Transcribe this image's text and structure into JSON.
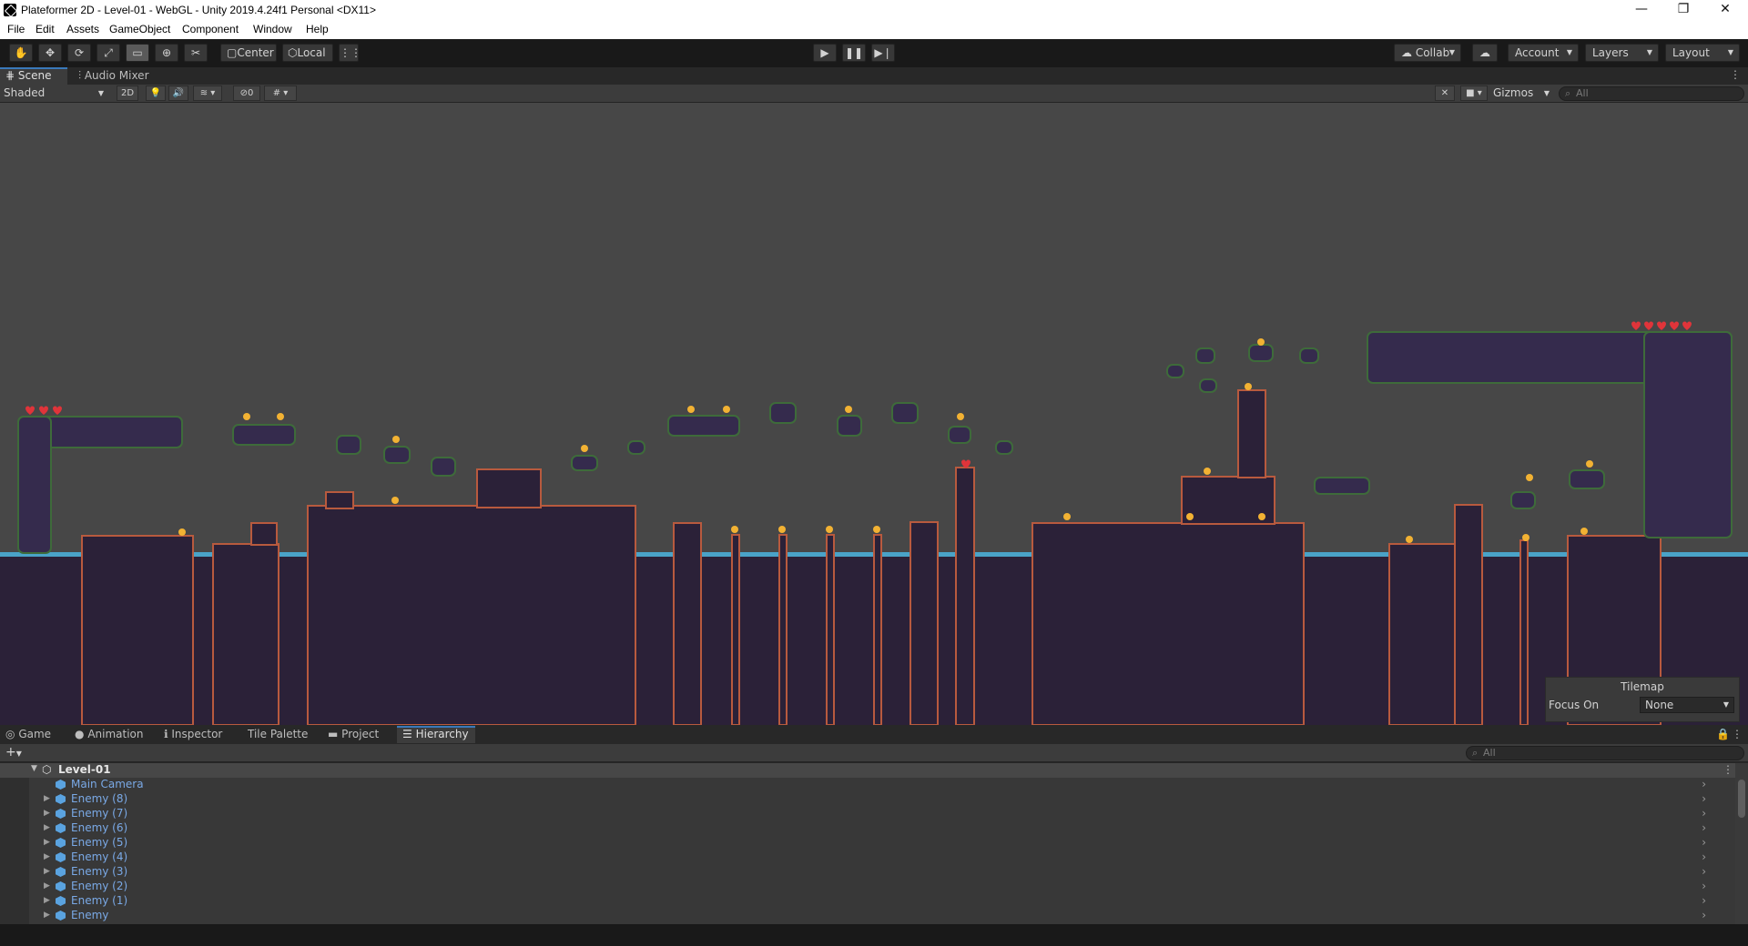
{
  "window": {
    "title": "Plateformer 2D - Level-01 - WebGL - Unity 2019.4.24f1 Personal <DX11>",
    "controls": [
      "—",
      "❐",
      "✕"
    ]
  },
  "menu": [
    "File",
    "Edit",
    "Assets",
    "GameObject",
    "Component",
    "Window",
    "Help"
  ],
  "toolbar": {
    "pivot_label": "Center",
    "space_label": "Local",
    "collab_label": "Collab",
    "account_label": "Account",
    "layers_label": "Layers",
    "layout_label": "Layout"
  },
  "scene_tabs": [
    {
      "label": "Scene",
      "icon": "scene-icon",
      "active": true
    },
    {
      "label": "Audio Mixer",
      "icon": "audio-mixer-icon",
      "active": false
    }
  ],
  "scene_toolbar": {
    "draw_mode": "Shaded",
    "mode_2d": "2D",
    "hidden_count": "0",
    "gizmos_label": "Gizmos",
    "search_placeholder": "All"
  },
  "tilemap_overlay": {
    "title": "Tilemap",
    "focus_label": "Focus On",
    "focus_value": "None"
  },
  "bottom_tabs": [
    {
      "label": "Game",
      "icon": "gamepad-icon"
    },
    {
      "label": "Animation",
      "icon": "animation-icon"
    },
    {
      "label": "Inspector",
      "icon": "info-icon"
    },
    {
      "label": "Tile Palette",
      "icon": ""
    },
    {
      "label": "Project",
      "icon": "folder-icon"
    },
    {
      "label": "Hierarchy",
      "icon": "list-icon",
      "active": true
    }
  ],
  "hierarchy": {
    "search_placeholder": "All",
    "scene_name": "Level-01",
    "items": [
      {
        "label": "Main Camera",
        "expandable": false
      },
      {
        "label": "Enemy (8)",
        "expandable": true
      },
      {
        "label": "Enemy (7)",
        "expandable": true
      },
      {
        "label": "Enemy (6)",
        "expandable": true
      },
      {
        "label": "Enemy (5)",
        "expandable": true
      },
      {
        "label": "Enemy (4)",
        "expandable": true
      },
      {
        "label": "Enemy (3)",
        "expandable": true
      },
      {
        "label": "Enemy (2)",
        "expandable": true
      },
      {
        "label": "Enemy (1)",
        "expandable": true
      },
      {
        "label": "Enemy",
        "expandable": true
      }
    ]
  },
  "colors": {
    "terrain": "#2b2138",
    "terrain_edge": "#b85a3e",
    "water": "#4aa3c8",
    "platform": "#352b4d",
    "moss": "#3e6b3a",
    "coin": "#f2b233",
    "heart": "#e0343a"
  }
}
